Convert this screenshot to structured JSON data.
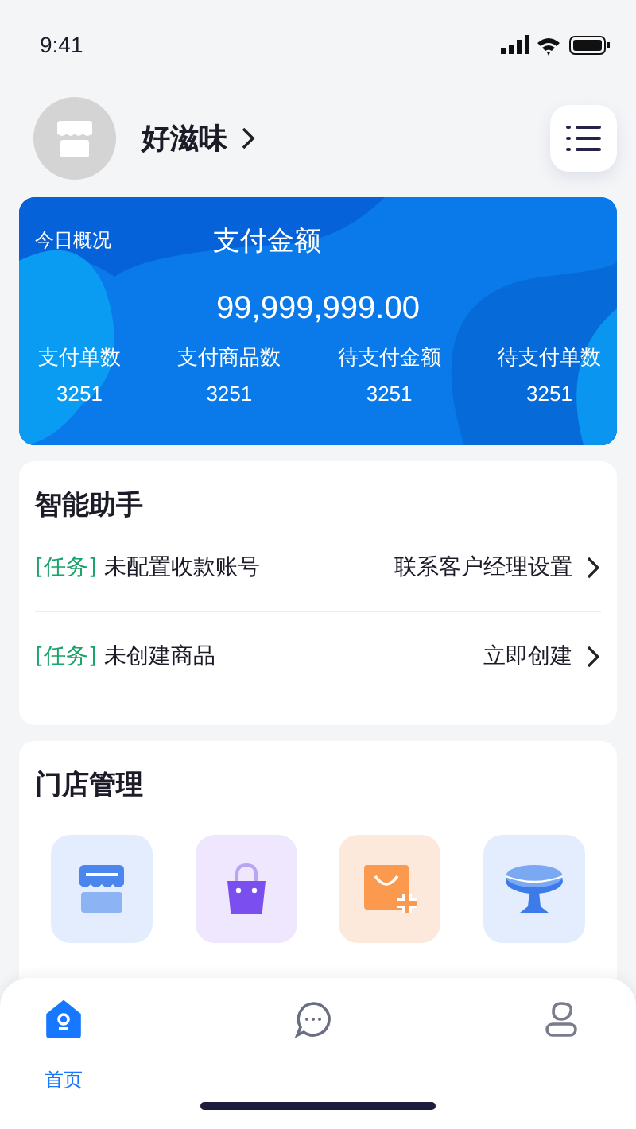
{
  "status_bar": {
    "time": "9:41"
  },
  "header": {
    "store_name": "好滋味"
  },
  "overview": {
    "label": "今日概况",
    "title": "支付金额",
    "amount": "99,999,999.00",
    "stats": [
      {
        "label": "支付单数",
        "value": "3251"
      },
      {
        "label": "支付商品数",
        "value": "3251"
      },
      {
        "label": "待支付金额",
        "value": "3251"
      },
      {
        "label": "待支付单数",
        "value": "3251"
      }
    ]
  },
  "assistant": {
    "title": "智能助手",
    "tasks": [
      {
        "tag": "[任务]",
        "text": "未配置收款账号",
        "action": "联系客户经理设置"
      },
      {
        "tag": "[任务]",
        "text": "未创建商品",
        "action": "立即创建"
      }
    ]
  },
  "store_management": {
    "title": "门店管理",
    "items": [
      {
        "kind": "store"
      },
      {
        "kind": "bag"
      },
      {
        "kind": "bag_plus"
      },
      {
        "kind": "table"
      }
    ]
  },
  "nav": {
    "items": [
      {
        "kind": "home",
        "label": "首页",
        "selected": true
      },
      {
        "kind": "chat",
        "selected": false
      },
      {
        "kind": "user",
        "selected": false
      }
    ]
  }
}
